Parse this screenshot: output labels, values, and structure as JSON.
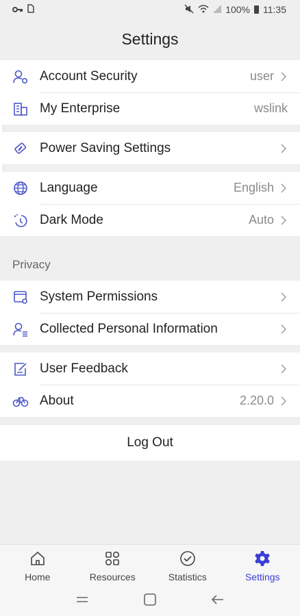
{
  "status_bar": {
    "battery": "100%",
    "time": "11:35"
  },
  "header": {
    "title": "Settings"
  },
  "groups": {
    "account": [
      {
        "label": "Account Security",
        "value": "user",
        "icon": "user-shield-icon"
      },
      {
        "label": "My Enterprise",
        "value": "wslink",
        "icon": "building-icon"
      }
    ],
    "power": [
      {
        "label": "Power Saving Settings",
        "value": "",
        "icon": "battery-icon"
      }
    ],
    "display": [
      {
        "label": "Language",
        "value": "English",
        "icon": "globe-icon"
      },
      {
        "label": "Dark Mode",
        "value": "Auto",
        "icon": "moon-icon"
      }
    ],
    "privacy_title": "Privacy",
    "privacy": [
      {
        "label": "System Permissions",
        "value": "",
        "icon": "window-gear-icon"
      },
      {
        "label": "Collected Personal Information",
        "value": "",
        "icon": "user-list-icon"
      }
    ],
    "about": [
      {
        "label": "User Feedback",
        "value": "",
        "icon": "feedback-icon"
      },
      {
        "label": "About",
        "value": "2.20.0",
        "icon": "info-icon"
      }
    ]
  },
  "logout": {
    "label": "Log Out"
  },
  "tabs": [
    {
      "label": "Home",
      "icon": "home-icon"
    },
    {
      "label": "Resources",
      "icon": "resources-icon"
    },
    {
      "label": "Statistics",
      "icon": "statistics-icon"
    },
    {
      "label": "Settings",
      "icon": "settings-gear-icon",
      "active": true
    }
  ],
  "colors": {
    "accent": "#3a3fd6",
    "icon": "#4b56c8",
    "background": "#efefef"
  }
}
